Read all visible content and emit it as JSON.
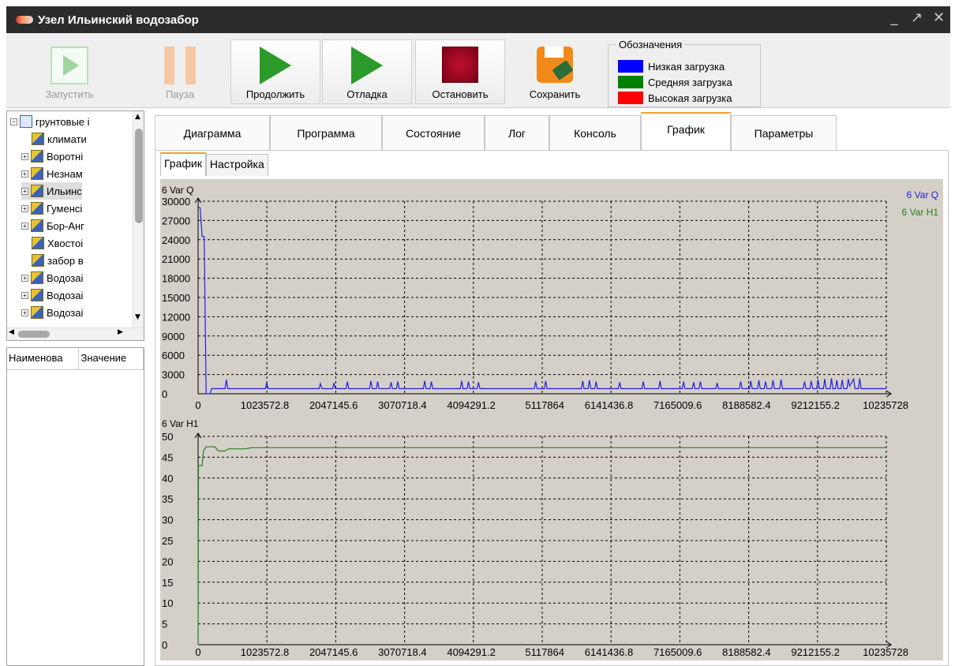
{
  "window": {
    "title": "Узел Ильинский водозабор",
    "controls": [
      "_",
      "↗",
      "✕"
    ]
  },
  "toolbar": {
    "buttons": [
      {
        "label": "Запустить",
        "enabled": false,
        "icon": "play-disabled-icon"
      },
      {
        "label": "Пауза",
        "enabled": false,
        "icon": "pause-icon"
      },
      {
        "label": "Продолжить",
        "enabled": true,
        "icon": "play-icon"
      },
      {
        "label": "Отладка",
        "enabled": true,
        "icon": "debug-play-icon"
      },
      {
        "label": "Остановить",
        "enabled": true,
        "icon": "stop-icon"
      },
      {
        "label": "Сохранить",
        "enabled": true,
        "icon": "save-icon"
      }
    ],
    "legend": {
      "title": "Обозначения",
      "items": [
        {
          "label": "Низкая загрузка",
          "color": "#0000ff"
        },
        {
          "label": "Средняя загрузка",
          "color": "#008000"
        },
        {
          "label": "Высокая загрузка",
          "color": "#ff0000"
        }
      ]
    }
  },
  "tree": {
    "root": "грунтовые i",
    "items": [
      {
        "label": "климати",
        "expandable": false
      },
      {
        "label": "Воротні",
        "expandable": true
      },
      {
        "label": "Незнам",
        "expandable": true
      },
      {
        "label": "Ильинс",
        "expandable": true,
        "selected": true
      },
      {
        "label": "Гуменсі",
        "expandable": true
      },
      {
        "label": "Бор-Анг",
        "expandable": true
      },
      {
        "label": "Хвостоі",
        "expandable": false
      },
      {
        "label": "забор в",
        "expandable": false
      },
      {
        "label": "Водозаі",
        "expandable": true
      },
      {
        "label": "Водозаі",
        "expandable": true
      },
      {
        "label": "Водозаі",
        "expandable": true
      }
    ]
  },
  "properties": {
    "columns": [
      "Наименова",
      "Значение"
    ]
  },
  "main_tabs": [
    "Диаграмма",
    "Программа",
    "Состояние",
    "Лог",
    "Консоль",
    "График",
    "Параметры"
  ],
  "active_main_tab": "График",
  "sub_tabs": [
    "График",
    "Настройка"
  ],
  "active_sub_tab": "График",
  "chart_data": [
    {
      "type": "line",
      "title": "6 Var Q",
      "series": [
        {
          "name": "6 Var Q",
          "color": "#2020e0"
        },
        {
          "name": "6 Var H1",
          "color": "#208020"
        }
      ],
      "x_ticks": [
        "0",
        "1023572.8",
        "2047145.6",
        "3070718.4",
        "4094291.2",
        "5117864",
        "6141436.8",
        "7165009.6",
        "8188582.4",
        "9212155.2",
        "10235728"
      ],
      "y_ticks": [
        "0",
        "3000",
        "6000",
        "9000",
        "12000",
        "15000",
        "18000",
        "21000",
        "24000",
        "27000",
        "30000"
      ],
      "xlim": [
        0,
        10235728
      ],
      "ylim": [
        0,
        30000
      ],
      "grid": true,
      "points": [
        [
          0,
          29000
        ],
        [
          30000,
          29000
        ],
        [
          60000,
          24500
        ],
        [
          90000,
          24500
        ],
        [
          120000,
          0
        ],
        [
          180000,
          0
        ],
        [
          200000,
          800
        ],
        [
          400000,
          800
        ],
        [
          420000,
          2200
        ],
        [
          440000,
          800
        ],
        [
          1000000,
          800
        ],
        [
          1020000,
          1800
        ],
        [
          1040000,
          800
        ],
        [
          1800000,
          800
        ],
        [
          1820000,
          1600
        ],
        [
          1840000,
          800
        ],
        [
          2000000,
          800
        ],
        [
          2020000,
          1700
        ],
        [
          2040000,
          800
        ],
        [
          2200000,
          800
        ],
        [
          2220000,
          1900
        ],
        [
          2240000,
          800
        ],
        [
          2550000,
          800
        ],
        [
          2570000,
          2000
        ],
        [
          2590000,
          800
        ],
        [
          2650000,
          800
        ],
        [
          2670000,
          1900
        ],
        [
          2690000,
          800
        ],
        [
          2850000,
          800
        ],
        [
          2870000,
          1800
        ],
        [
          2890000,
          800
        ],
        [
          2950000,
          800
        ],
        [
          2970000,
          1900
        ],
        [
          2990000,
          800
        ],
        [
          3350000,
          800
        ],
        [
          3370000,
          2000
        ],
        [
          3390000,
          800
        ],
        [
          3450000,
          800
        ],
        [
          3470000,
          1900
        ],
        [
          3490000,
          800
        ],
        [
          3900000,
          800
        ],
        [
          3920000,
          2000
        ],
        [
          3940000,
          800
        ],
        [
          4000000,
          800
        ],
        [
          4020000,
          1900
        ],
        [
          4040000,
          800
        ],
        [
          4150000,
          800
        ],
        [
          4170000,
          1800
        ],
        [
          4190000,
          800
        ],
        [
          5000000,
          800
        ],
        [
          5020000,
          1900
        ],
        [
          5040000,
          800
        ],
        [
          5150000,
          800
        ],
        [
          5170000,
          2000
        ],
        [
          5190000,
          800
        ],
        [
          5700000,
          800
        ],
        [
          5720000,
          2000
        ],
        [
          5740000,
          800
        ],
        [
          5800000,
          800
        ],
        [
          5820000,
          2100
        ],
        [
          5840000,
          800
        ],
        [
          5900000,
          800
        ],
        [
          5920000,
          1900
        ],
        [
          5940000,
          800
        ],
        [
          6250000,
          800
        ],
        [
          6270000,
          1800
        ],
        [
          6290000,
          800
        ],
        [
          6600000,
          800
        ],
        [
          6620000,
          1900
        ],
        [
          6640000,
          800
        ],
        [
          6850000,
          800
        ],
        [
          6870000,
          2000
        ],
        [
          6890000,
          800
        ],
        [
          7200000,
          800
        ],
        [
          7220000,
          1900
        ],
        [
          7240000,
          800
        ],
        [
          7350000,
          800
        ],
        [
          7370000,
          1800
        ],
        [
          7390000,
          800
        ],
        [
          7450000,
          800
        ],
        [
          7470000,
          1900
        ],
        [
          7490000,
          800
        ],
        [
          7700000,
          800
        ],
        [
          7720000,
          1700
        ],
        [
          7740000,
          800
        ],
        [
          8050000,
          800
        ],
        [
          8070000,
          1900
        ],
        [
          8090000,
          800
        ],
        [
          8200000,
          800
        ],
        [
          8220000,
          2000
        ],
        [
          8240000,
          800
        ],
        [
          8320000,
          800
        ],
        [
          8340000,
          2100
        ],
        [
          8360000,
          800
        ],
        [
          8420000,
          800
        ],
        [
          8440000,
          1900
        ],
        [
          8460000,
          800
        ],
        [
          8530000,
          800
        ],
        [
          8550000,
          2100
        ],
        [
          8570000,
          800
        ],
        [
          8650000,
          800
        ],
        [
          8670000,
          2200
        ],
        [
          8690000,
          800
        ],
        [
          9000000,
          800
        ],
        [
          9020000,
          1900
        ],
        [
          9040000,
          800
        ],
        [
          9100000,
          800
        ],
        [
          9120000,
          2000
        ],
        [
          9140000,
          800
        ],
        [
          9200000,
          800
        ],
        [
          9220000,
          2200
        ],
        [
          9240000,
          800
        ],
        [
          9300000,
          800
        ],
        [
          9320000,
          2300
        ],
        [
          9340000,
          800
        ],
        [
          9400000,
          800
        ],
        [
          9420000,
          2400
        ],
        [
          9440000,
          800
        ],
        [
          9480000,
          800
        ],
        [
          9500000,
          2100
        ],
        [
          9520000,
          800
        ],
        [
          9560000,
          800
        ],
        [
          9580000,
          2200
        ],
        [
          9600000,
          800
        ],
        [
          9650000,
          800
        ],
        [
          9670000,
          2300
        ],
        [
          9690000,
          1200
        ],
        [
          9750000,
          2300
        ],
        [
          9770000,
          800
        ],
        [
          9820000,
          800
        ],
        [
          9840000,
          2400
        ],
        [
          9860000,
          800
        ],
        [
          10235728,
          800
        ]
      ]
    },
    {
      "type": "line",
      "title": "6 Var H1",
      "series": [
        {
          "name": "6 Var H1",
          "color": "#208020"
        }
      ],
      "x_ticks": [
        "0",
        "1023572.8",
        "2047145.6",
        "3070718.4",
        "4094291.2",
        "5117864",
        "6141436.8",
        "7165009.6",
        "8188582.4",
        "9212155.2",
        "10235728"
      ],
      "y_ticks": [
        "0",
        "5",
        "10",
        "15",
        "20",
        "25",
        "30",
        "35",
        "40",
        "45",
        "50"
      ],
      "xlim": [
        0,
        10235728
      ],
      "ylim": [
        0,
        50
      ],
      "grid": true,
      "points": [
        [
          0,
          0
        ],
        [
          5000,
          43
        ],
        [
          60000,
          43
        ],
        [
          80000,
          46.5
        ],
        [
          120000,
          47.5
        ],
        [
          250000,
          47.5
        ],
        [
          300000,
          46.5
        ],
        [
          400000,
          46.5
        ],
        [
          450000,
          47
        ],
        [
          700000,
          47
        ],
        [
          800000,
          47.3
        ],
        [
          10235728,
          47.3
        ]
      ]
    }
  ]
}
